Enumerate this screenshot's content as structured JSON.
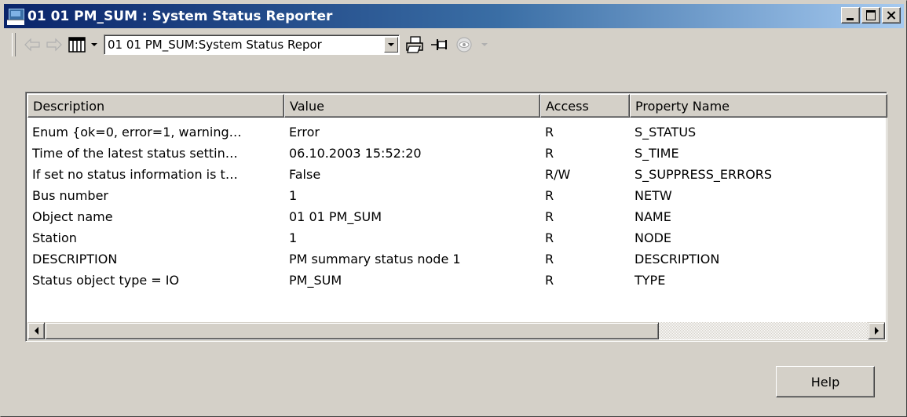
{
  "window": {
    "title": "01 01 PM_SUM : System Status Reporter"
  },
  "toolbar": {
    "object_select_value": "01 01 PM_SUM:System Status Repor",
    "icons": [
      "back-arrow-icon",
      "forward-arrow-icon",
      "columns-icon",
      "print-icon",
      "pin-icon",
      "eye-icon"
    ]
  },
  "table": {
    "columns": [
      "Description",
      "Value",
      "Access",
      "Property Name"
    ],
    "rows": [
      [
        "Enum {ok=0, error=1, warning…",
        "Error",
        "R",
        "S_STATUS"
      ],
      [
        "Time of the latest status settin…",
        "06.10.2003 15:52:20",
        "R",
        "S_TIME"
      ],
      [
        "If set no status information is t…",
        "False",
        "R/W",
        "S_SUPPRESS_ERRORS"
      ],
      [
        "Bus number",
        "1",
        "R",
        "NETW"
      ],
      [
        "Object name",
        "01 01 PM_SUM",
        "R",
        "NAME"
      ],
      [
        "Station",
        "1",
        "R",
        "NODE"
      ],
      [
        "DESCRIPTION",
        "PM summary status node 1",
        "R",
        "DESCRIPTION"
      ],
      [
        "Status object type = IO",
        "PM_SUM",
        "R",
        "TYPE"
      ]
    ]
  },
  "buttons": {
    "help_label": "Help"
  },
  "colors": {
    "titlebar_start": "#0a246a",
    "titlebar_end": "#a6caf0",
    "face": "#d4d0c8"
  }
}
